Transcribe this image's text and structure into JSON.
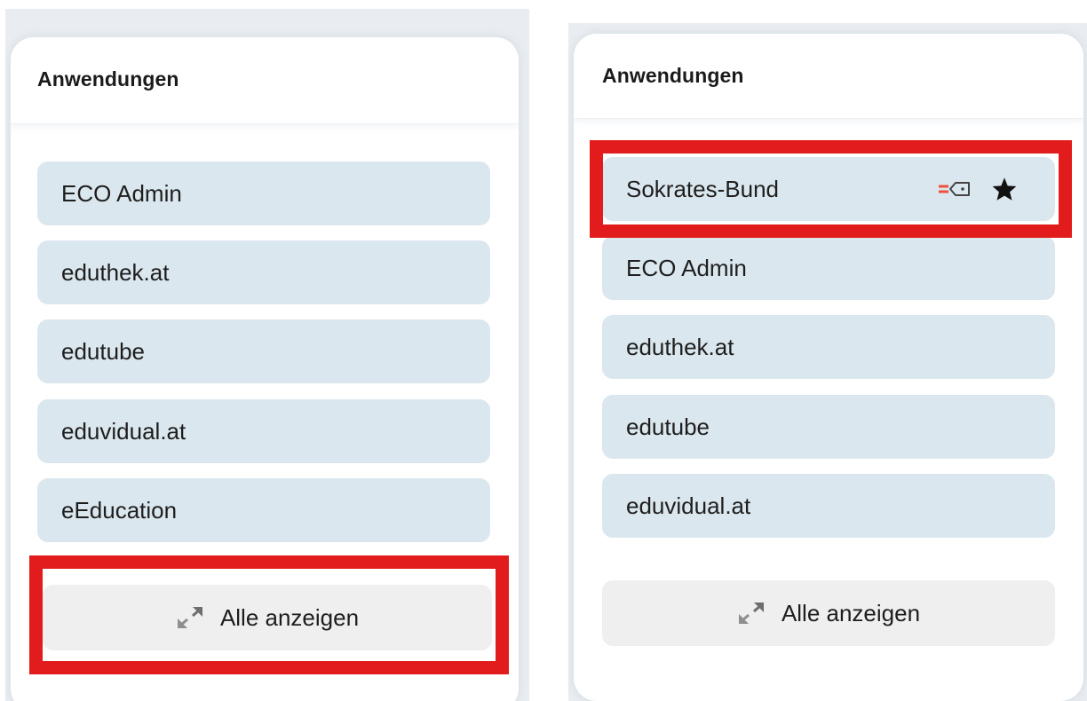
{
  "left_panel": {
    "title": "Anwendungen",
    "apps": [
      {
        "label": "ECO Admin"
      },
      {
        "label": "eduthek.at"
      },
      {
        "label": "edutube"
      },
      {
        "label": "eduvidual.at"
      },
      {
        "label": "eEducation"
      }
    ],
    "show_all_label": "Alle anzeigen"
  },
  "right_panel": {
    "title": "Anwendungen",
    "pinned_app": {
      "label": "Sokrates-Bund",
      "icons": [
        "login-tag-icon",
        "star-icon"
      ]
    },
    "apps": [
      {
        "label": "ECO Admin"
      },
      {
        "label": "eduthek.at"
      },
      {
        "label": "edutube"
      },
      {
        "label": "eduvidual.at"
      }
    ],
    "show_all_label": "Alle anzeigen"
  },
  "colors": {
    "item_background": "#dbe7ee",
    "show_all_background": "#efefef",
    "highlight": "#e21c1c",
    "backdrop": "#e9edf1",
    "tag_accent": "#f0503c"
  },
  "icons": {
    "expand": "expand-arrows-icon",
    "star": "star-icon",
    "tag": "login-tag-icon"
  }
}
